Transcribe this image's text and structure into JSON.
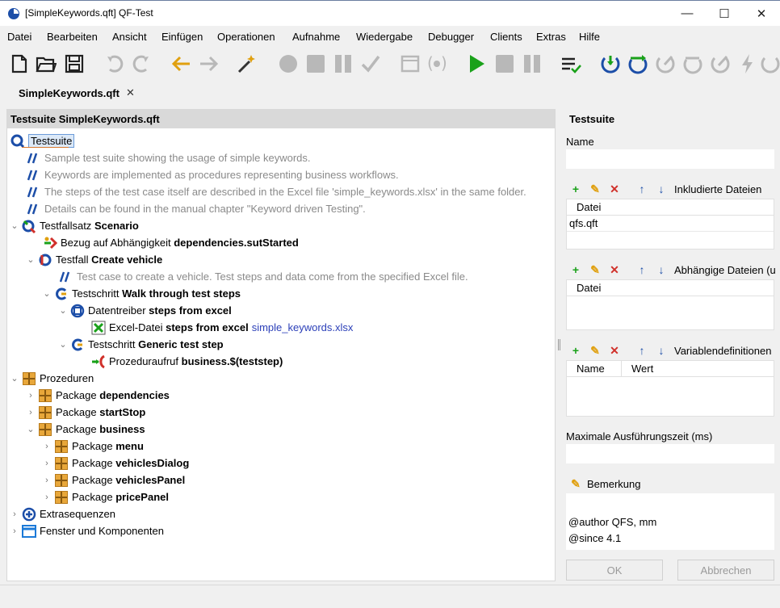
{
  "window": {
    "title": "[SimpleKeywords.qft] QF-Test",
    "controls": {
      "minimize": "—",
      "maximize": "☐",
      "close": "✕"
    }
  },
  "menu": [
    "Datei",
    "Bearbeiten",
    "Ansicht",
    "Einfügen",
    "Operationen",
    "Aufnahme",
    "Wiedergabe",
    "Debugger",
    "Clients",
    "Extras",
    "Hilfe"
  ],
  "toolbar": {
    "icons": [
      "new-file-icon",
      "open-folder-icon",
      "save-icon",
      "undo-icon",
      "redo-icon",
      "back-arrow-icon",
      "forward-arrow-icon",
      "magic-wand-icon",
      "record-icon",
      "stop-record-icon",
      "pause-record-icon",
      "check-icon",
      "component-icon",
      "procedure-record-icon",
      "play-icon",
      "stop-icon",
      "pause-icon",
      "run-log-icon",
      "step-in-icon",
      "step-over-icon",
      "step-out-icon",
      "skip-icon",
      "continue-icon",
      "arrow-step-icon",
      "lightning-icon"
    ]
  },
  "tab": {
    "label": "SimpleKeywords.qft",
    "close": "✕"
  },
  "tree": {
    "header": "Testsuite SimpleKeywords.qft",
    "rows": [
      {
        "type": "testsuite",
        "text": "Testsuite"
      },
      {
        "type": "comment",
        "text": "Sample test suite showing the usage of simple keywords."
      },
      {
        "type": "comment",
        "text": "Keywords are implemented as procedures representing business workflows."
      },
      {
        "type": "comment",
        "text": "The steps of the test case itself are described in the Excel file 'simple_keywords.xlsx' in the same folder."
      },
      {
        "type": "comment",
        "text": "Details can be found in the manual chapter \"Keyword driven Testing\"."
      },
      {
        "type": "testset",
        "prefix": "Testfallsatz",
        "name": "Scenario",
        "expander": "⌄"
      },
      {
        "type": "dependency",
        "prefix": "Bezug auf Abhängigkeit",
        "name": "dependencies.sutStarted"
      },
      {
        "type": "testcase",
        "prefix": "Testfall",
        "name": "Create vehicle",
        "expander": "⌄"
      },
      {
        "type": "comment",
        "text": "Test case to create a vehicle. Test steps and data come from the specified Excel file."
      },
      {
        "type": "teststep",
        "prefix": "Testschritt",
        "name": "Walk through test steps",
        "expander": "⌄"
      },
      {
        "type": "datadriver",
        "prefix": "Datentreiber",
        "name": "steps from excel",
        "expander": "⌄"
      },
      {
        "type": "excel",
        "prefix": "Excel-Datei",
        "name": "steps from excel",
        "link": "simple_keywords.xlsx"
      },
      {
        "type": "teststep",
        "prefix": "Testschritt",
        "name": "Generic test step",
        "expander": "⌄"
      },
      {
        "type": "call",
        "prefix": "Prozeduraufruf",
        "name": "business.$(teststep)"
      },
      {
        "type": "procedures",
        "prefix": "Prozeduren",
        "name": "",
        "expander": "⌄"
      },
      {
        "type": "package",
        "prefix": "Package",
        "name": "dependencies",
        "expander": "›"
      },
      {
        "type": "package",
        "prefix": "Package",
        "name": "startStop",
        "expander": "›"
      },
      {
        "type": "package",
        "prefix": "Package",
        "name": "business",
        "expander": "⌄"
      },
      {
        "type": "package",
        "prefix": "Package",
        "name": "menu",
        "expander": "›"
      },
      {
        "type": "package",
        "prefix": "Package",
        "name": "vehiclesDialog",
        "expander": "›"
      },
      {
        "type": "package",
        "prefix": "Package",
        "name": "vehiclesPanel",
        "expander": "›"
      },
      {
        "type": "package",
        "prefix": "Package",
        "name": "pricePanel",
        "expander": "›"
      },
      {
        "type": "extras",
        "prefix": "Extrasequenzen",
        "name": "",
        "expander": "›"
      },
      {
        "type": "windows",
        "prefix": "Fenster und Komponenten",
        "name": "",
        "expander": "›"
      }
    ]
  },
  "details": {
    "title": "Testsuite",
    "name_label": "Name",
    "name_value": "",
    "included_label": "Inkludierte Dateien",
    "included_col": "Datei",
    "included_rows": [
      "qfs.qft"
    ],
    "dependent_label": "Abhängige Dateien (u",
    "dependent_col": "Datei",
    "vars_label": "Variablendefinitionen",
    "vars_cols": [
      "Name",
      "Wert"
    ],
    "max_time_label": "Maximale Ausführungszeit (ms)",
    "max_time_value": "",
    "comment_label": "Bemerkung",
    "comment_lines": [
      "@author QFS, mm",
      "@since 4.1"
    ],
    "ok": "OK",
    "cancel": "Abbrechen",
    "table_tools": [
      "+",
      "✎",
      "✕",
      "↑",
      "↓"
    ]
  },
  "colors": {
    "accent_blue": "#1c4ea8",
    "play_green": "#1aa11a",
    "wand_orange": "#e0a010",
    "disabled_gray": "#b8b8b8"
  }
}
